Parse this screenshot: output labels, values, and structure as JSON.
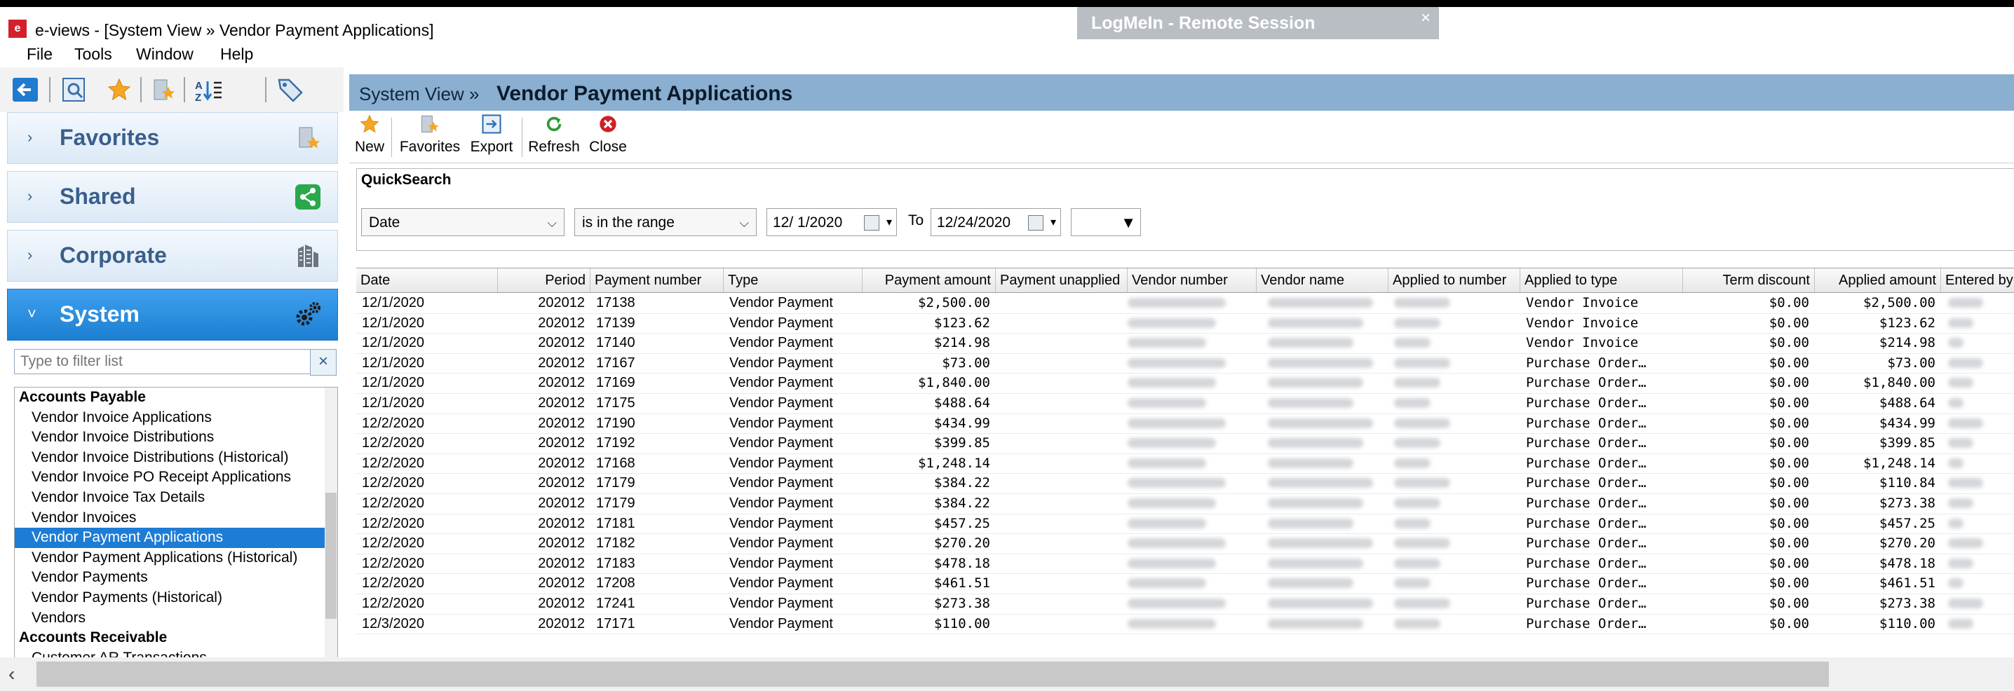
{
  "window": {
    "title": "e-views - [System View » Vendor Payment Applications]",
    "app_icon_glyph": "e",
    "remote_session": "LogMeIn -  Remote Session",
    "remote_close": "×"
  },
  "menu": [
    "File",
    "Tools",
    "Window",
    "Help"
  ],
  "sidebar": {
    "sections": [
      {
        "label": "Favorites",
        "arrow": "›",
        "icon": "bookmark-icon"
      },
      {
        "label": "Shared",
        "arrow": "›",
        "icon": "share-icon"
      },
      {
        "label": "Corporate",
        "arrow": "›",
        "icon": "building-icon"
      },
      {
        "label": "System",
        "arrow": "˅",
        "icon": "gears-icon"
      }
    ],
    "filter_placeholder": "Type to filter list",
    "filter_clear": "×",
    "items": [
      {
        "label": "Accounts Payable",
        "group": true
      },
      {
        "label": "Vendor Invoice Applications"
      },
      {
        "label": "Vendor Invoice Distributions"
      },
      {
        "label": "Vendor Invoice Distributions (Historical)"
      },
      {
        "label": "Vendor Invoice PO Receipt Applications"
      },
      {
        "label": "Vendor Invoice Tax Details"
      },
      {
        "label": "Vendor Invoices"
      },
      {
        "label": "Vendor Payment Applications",
        "selected": true
      },
      {
        "label": "Vendor Payment Applications (Historical)"
      },
      {
        "label": "Vendor Payments"
      },
      {
        "label": "Vendor Payments (Historical)"
      },
      {
        "label": "Vendors"
      },
      {
        "label": "Accounts Receivable",
        "group": true
      },
      {
        "label": "Customer AR Transactions"
      }
    ]
  },
  "header": {
    "breadcrumb": "System View »",
    "title": "Vendor Payment Applications"
  },
  "actions": [
    {
      "label": "New",
      "icon": "star-icon"
    },
    {
      "label": "Favorites",
      "icon": "favorites-icon"
    },
    {
      "label": "Export",
      "icon": "export-icon"
    },
    {
      "label": "Refresh",
      "icon": "refresh-icon"
    },
    {
      "label": "Close",
      "icon": "close-icon"
    }
  ],
  "quicksearch": {
    "title": "QuickSearch",
    "field": "Date",
    "operator": "is in the range",
    "from": "12/ 1/2020",
    "to_label": "To",
    "to": "12/24/2020",
    "extra": ""
  },
  "grid": {
    "columns": [
      "Date",
      "Period",
      "Payment number",
      "Type",
      "Payment amount",
      "Payment unapplied",
      "Vendor number",
      "Vendor name",
      "Applied to number",
      "Applied to type",
      "Term discount",
      "Applied amount",
      "Entered by"
    ],
    "rows": [
      [
        "12/1/2020",
        "202012",
        "17138",
        "Vendor Payment",
        "$2,500.00",
        "Vendor Invoice",
        "$0.00",
        "$2,500.00"
      ],
      [
        "12/1/2020",
        "202012",
        "17139",
        "Vendor Payment",
        "$123.62",
        "Vendor Invoice",
        "$0.00",
        "$123.62"
      ],
      [
        "12/1/2020",
        "202012",
        "17140",
        "Vendor Payment",
        "$214.98",
        "Vendor Invoice",
        "$0.00",
        "$214.98"
      ],
      [
        "12/1/2020",
        "202012",
        "17167",
        "Vendor Payment",
        "$73.00",
        "Purchase Order…",
        "$0.00",
        "$73.00"
      ],
      [
        "12/1/2020",
        "202012",
        "17169",
        "Vendor Payment",
        "$1,840.00",
        "Purchase Order…",
        "$0.00",
        "$1,840.00"
      ],
      [
        "12/1/2020",
        "202012",
        "17175",
        "Vendor Payment",
        "$488.64",
        "Purchase Order…",
        "$0.00",
        "$488.64"
      ],
      [
        "12/2/2020",
        "202012",
        "17190",
        "Vendor Payment",
        "$434.99",
        "Purchase Order…",
        "$0.00",
        "$434.99"
      ],
      [
        "12/2/2020",
        "202012",
        "17192",
        "Vendor Payment",
        "$399.85",
        "Purchase Order…",
        "$0.00",
        "$399.85"
      ],
      [
        "12/2/2020",
        "202012",
        "17168",
        "Vendor Payment",
        "$1,248.14",
        "Purchase Order…",
        "$0.00",
        "$1,248.14"
      ],
      [
        "12/2/2020",
        "202012",
        "17179",
        "Vendor Payment",
        "$384.22",
        "Purchase Order…",
        "$0.00",
        "$110.84"
      ],
      [
        "12/2/2020",
        "202012",
        "17179",
        "Vendor Payment",
        "$384.22",
        "Purchase Order…",
        "$0.00",
        "$273.38"
      ],
      [
        "12/2/2020",
        "202012",
        "17181",
        "Vendor Payment",
        "$457.25",
        "Purchase Order…",
        "$0.00",
        "$457.25"
      ],
      [
        "12/2/2020",
        "202012",
        "17182",
        "Vendor Payment",
        "$270.20",
        "Purchase Order…",
        "$0.00",
        "$270.20"
      ],
      [
        "12/2/2020",
        "202012",
        "17183",
        "Vendor Payment",
        "$478.18",
        "Purchase Order…",
        "$0.00",
        "$478.18"
      ],
      [
        "12/2/2020",
        "202012",
        "17208",
        "Vendor Payment",
        "$461.51",
        "Purchase Order…",
        "$0.00",
        "$461.51"
      ],
      [
        "12/2/2020",
        "202012",
        "17241",
        "Vendor Payment",
        "$273.38",
        "Purchase Order…",
        "$0.00",
        "$273.38"
      ],
      [
        "12/3/2020",
        "202012",
        "17171",
        "Vendor Payment",
        "$110.00",
        "Purchase Order…",
        "$0.00",
        "$110.00"
      ]
    ]
  },
  "scrollbar": {
    "left_arrow": "‹"
  },
  "colors": {
    "accent": "#1d7cd4",
    "section_header": "#8aafd0",
    "nav_text": "#3a5f8d"
  }
}
